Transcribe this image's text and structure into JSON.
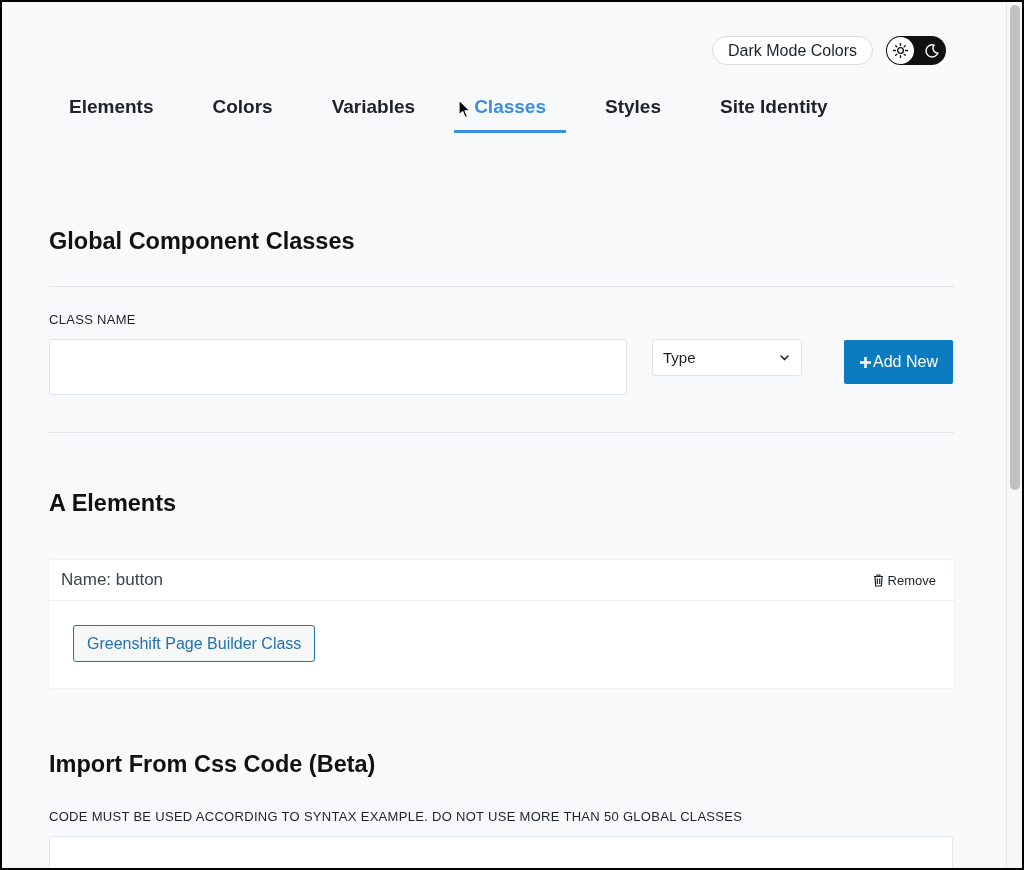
{
  "header": {
    "dark_mode_button": "Dark Mode Colors",
    "theme_toggle": {
      "on": false
    }
  },
  "tabs": [
    {
      "label": "Elements",
      "selected": false
    },
    {
      "label": "Colors",
      "selected": false
    },
    {
      "label": "Variables",
      "selected": false
    },
    {
      "label": "Classes",
      "selected": true
    },
    {
      "label": "Styles",
      "selected": false
    },
    {
      "label": "Site Identity",
      "selected": false
    }
  ],
  "global_classes": {
    "title": "Global Component Classes",
    "class_name_label": "CLASS NAME",
    "type_select": {
      "value": "Type"
    },
    "add_button": "Add New"
  },
  "a_elements": {
    "title": "A Elements",
    "items": [
      {
        "name": "Name: button",
        "remove_label": "Remove",
        "tags": [
          "Greenshift Page Builder Class"
        ]
      }
    ]
  },
  "import": {
    "title": "Import From Css Code (Beta)",
    "hint": "CODE MUST BE USED ACCORDING TO SYNTAX EXAMPLE. DO NOT USE MORE THAN 50 GLOBAL CLASSES"
  }
}
